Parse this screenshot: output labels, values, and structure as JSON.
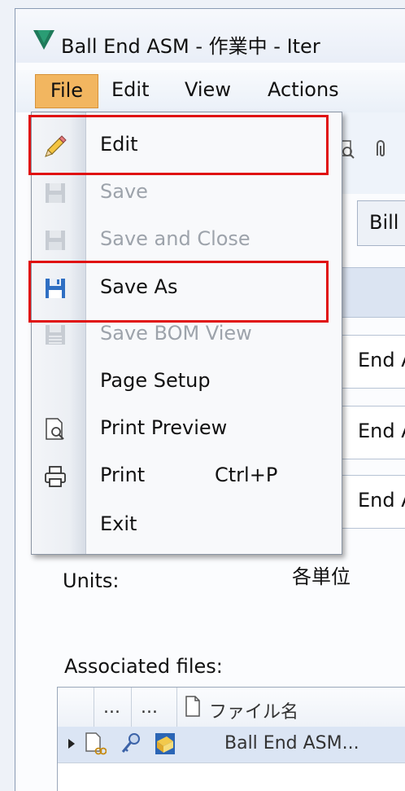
{
  "window": {
    "title": "Ball End ASM - 作業中 - Iter"
  },
  "menubar": {
    "file": "File",
    "edit": "Edit",
    "view": "View",
    "actions": "Actions"
  },
  "file_menu": {
    "items": [
      {
        "label": "Edit",
        "icon": "pencil-icon",
        "enabled": true
      },
      {
        "label": "Save",
        "icon": "floppy-disk-icon",
        "enabled": false
      },
      {
        "label": "Save and Close",
        "icon": "floppy-disk-icon",
        "enabled": false
      },
      {
        "label": "Save As",
        "icon": "floppy-disk-icon",
        "enabled": true
      },
      {
        "label": "Save BOM View",
        "icon": "save-bom-icon",
        "enabled": false
      },
      {
        "label": "Page Setup",
        "icon": "",
        "enabled": true
      },
      {
        "label": "Print Preview",
        "icon": "print-preview-icon",
        "enabled": true
      },
      {
        "label": "Print",
        "icon": "printer-icon",
        "enabled": true,
        "shortcut": "Ctrl+P"
      },
      {
        "label": "Exit",
        "icon": "",
        "enabled": true
      }
    ]
  },
  "background": {
    "tab_label": "Bill",
    "fields": [
      "End A",
      "End A",
      "End A"
    ],
    "units_label": "Units:",
    "units_value": "各単位",
    "associated_files_label": "Associated files:"
  },
  "grid": {
    "header": {
      "col1": "...",
      "col2": "...",
      "name_col": "ファイル名"
    },
    "rows": [
      {
        "name": "Ball End ASM..."
      }
    ]
  },
  "colors": {
    "menu_file_active": "#f2b660",
    "highlight_red": "#e01010",
    "disabled_text": "#9da3ab"
  }
}
